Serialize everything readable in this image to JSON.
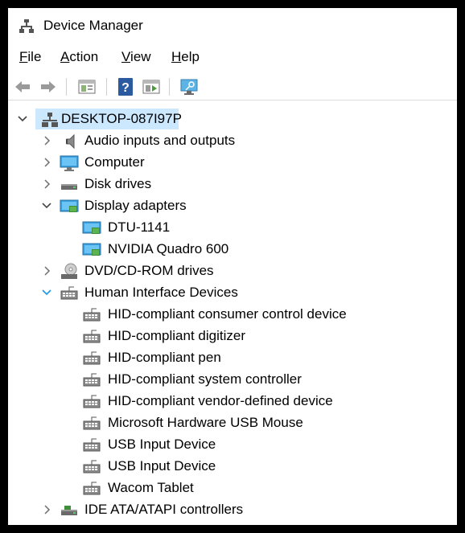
{
  "window": {
    "title": "Device Manager"
  },
  "menu": {
    "file": {
      "accel": "F",
      "rest": "ile"
    },
    "action": {
      "accel": "A",
      "rest": "ction"
    },
    "view": {
      "accel": "V",
      "rest": "iew"
    },
    "help": {
      "accel": "H",
      "rest": "elp"
    }
  },
  "toolbar": {
    "buttons": [
      "back-icon",
      "forward-icon",
      "properties-icon",
      "help-icon",
      "update-driver-icon",
      "scan-hardware-icon"
    ]
  },
  "tree": {
    "root": {
      "label": "DESKTOP-087I97P",
      "expanded": true,
      "selected": true
    },
    "categories": [
      {
        "label": "Audio inputs and outputs",
        "icon": "speaker-icon",
        "expanded": false
      },
      {
        "label": "Computer",
        "icon": "monitor-icon",
        "expanded": false
      },
      {
        "label": "Disk drives",
        "icon": "disk-drive-icon",
        "expanded": false
      },
      {
        "label": "Display adapters",
        "icon": "display-adapter-icon",
        "expanded": true,
        "children": [
          "DTU-1141",
          "NVIDIA Quadro 600"
        ]
      },
      {
        "label": "DVD/CD-ROM drives",
        "icon": "dvd-drive-icon",
        "expanded": false
      },
      {
        "label": "Human Interface Devices",
        "icon": "hid-icon",
        "expanded": true,
        "children": [
          "HID-compliant consumer control device",
          "HID-compliant digitizer",
          "HID-compliant pen",
          "HID-compliant system controller",
          "HID-compliant vendor-defined device",
          "Microsoft Hardware USB Mouse",
          "USB Input Device",
          "USB Input Device",
          "Wacom Tablet"
        ]
      },
      {
        "label": "IDE ATA/ATAPI controllers",
        "icon": "ide-controller-icon",
        "expanded": false
      }
    ]
  },
  "colors": {
    "selection": "#cce8ff",
    "chevron": "#6e6e6e",
    "chevron_active": "#1c97ea"
  }
}
